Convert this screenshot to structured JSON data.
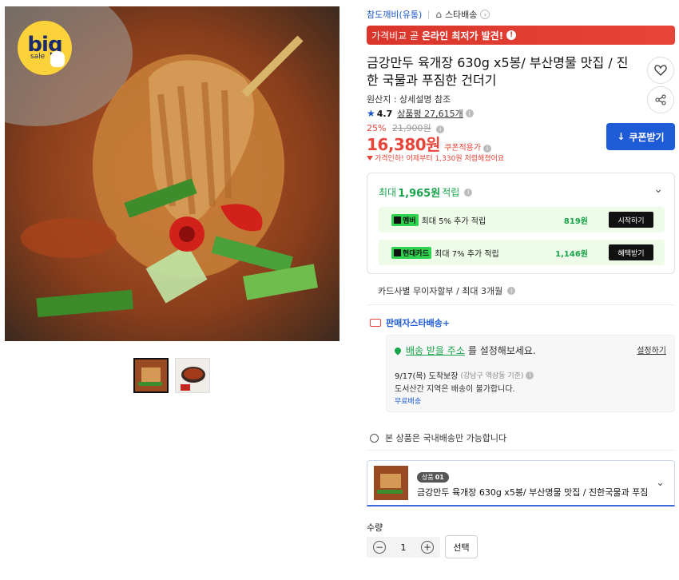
{
  "hero": {
    "badge_big": "big",
    "badge_sale": "sale"
  },
  "breadcrumb": {
    "seller": "참도깨비(유통)",
    "star": "스타배송"
  },
  "price_banner": {
    "prefix": "가격비교 곧",
    "highlight": "온라인 최저가 발견!",
    "alert": "!"
  },
  "product": {
    "title": "금강만두 육개장 630g x5봉/ 부산명물 맛집 / 진한 국물과 푸짐한 건더기",
    "origin": "원산지 : 상세설명 참조",
    "rating": "4.7",
    "review_label": "상품평 27,615개",
    "discount_pct": "25%",
    "original_price": "21,900원",
    "price": "16,380원",
    "coupon_applied": "쿠폰적용가",
    "price_drop": "가격인하! 어제부터 1,330원 저렴해졌어요"
  },
  "actions": {
    "coupon_btn": "쿠폰받기"
  },
  "points": {
    "head_prefix": "최대",
    "head_amount": "1,965원",
    "head_suffix": "적립",
    "rows": [
      {
        "tag": "멤버",
        "text": "최대 5% 추가 적립",
        "amount": "819원",
        "button": "시작하기"
      },
      {
        "tag": "현대카드",
        "text": "최대 7% 추가 적립",
        "amount": "1,146원",
        "button": "혜택받기"
      }
    ],
    "installment": "카드사별 무이자할부 / 최대 3개월"
  },
  "shipping": {
    "seller_label": "판매자스타배송+",
    "addr_link": "배송 받을 주소",
    "addr_suffix": "를 설정해보세요.",
    "set_btn": "설정하기",
    "date": "9/17(목) 도착보장",
    "region": "(강남구 역삼동 기준)",
    "island": "도서산간 지역은 배송이 불가합니다.",
    "free": "무료배송",
    "domestic": "본 상품은 국내배송만 가능합니다"
  },
  "option": {
    "tag": "상품",
    "tag_no": "01",
    "name": "금강만두 육개장 630g x5봉/ 부산명물 맛집 / 진한국물과 푸짐..."
  },
  "quantity": {
    "label": "수량",
    "value": "1",
    "minus": "−",
    "plus": "+",
    "select": "선택"
  },
  "colors": {
    "accent_blue": "#1e5bd6",
    "sale_red": "#e8453a",
    "points_green": "#17a34a"
  }
}
